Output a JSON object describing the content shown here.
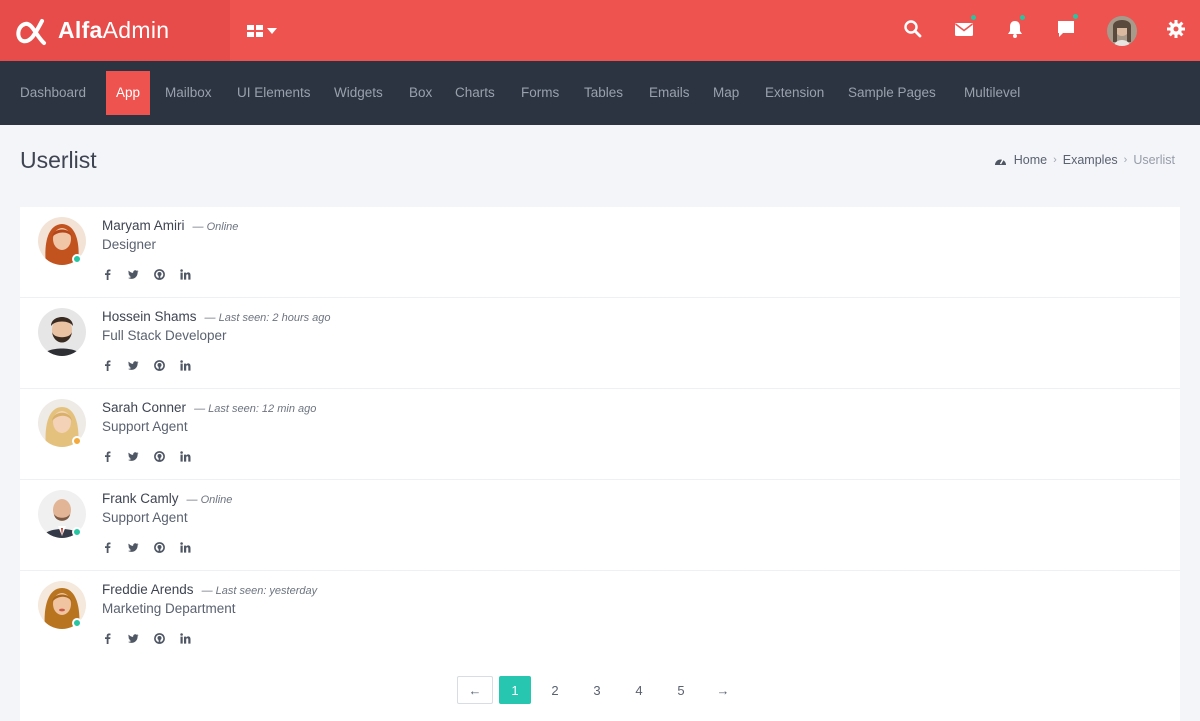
{
  "brand": {
    "bold": "Alfa",
    "light": "Admin"
  },
  "colors": {
    "primary": "#ef5350",
    "nav_bg": "#2c3442",
    "online": "#26c6a2",
    "away": "#f4a93a",
    "accent": "#26c6b0"
  },
  "nav": {
    "items": [
      "Dashboard",
      "App",
      "Mailbox",
      "UI Elements",
      "Widgets",
      "Box",
      "Charts",
      "Forms",
      "Tables",
      "Emails",
      "Map",
      "Extension",
      "Sample Pages",
      "Multilevel"
    ],
    "active": "App"
  },
  "page": {
    "title": "Userlist"
  },
  "breadcrumb": {
    "home": "Home",
    "parent": "Examples",
    "current": "Userlist"
  },
  "users": [
    {
      "name": "Maryam Amiri",
      "status_text": "— Online",
      "role": "Designer",
      "status": "online"
    },
    {
      "name": "Hossein Shams",
      "status_text": "— Last seen: 2 hours ago",
      "role": "Full Stack Developer",
      "status": "none"
    },
    {
      "name": "Sarah Conner",
      "status_text": "— Last seen: 12 min ago",
      "role": "Support Agent",
      "status": "away"
    },
    {
      "name": "Frank Camly",
      "status_text": "— Online",
      "role": "Support Agent",
      "status": "online"
    },
    {
      "name": "Freddie Arends",
      "status_text": "— Last seen: yesterday",
      "role": "Marketing Department",
      "status": "online"
    }
  ],
  "socials": [
    "facebook-icon",
    "twitter-icon",
    "github-icon",
    "linkedin-icon"
  ],
  "pagination": {
    "prev": "←",
    "pages": [
      "1",
      "2",
      "3",
      "4",
      "5"
    ],
    "next": "→",
    "current": "1"
  }
}
